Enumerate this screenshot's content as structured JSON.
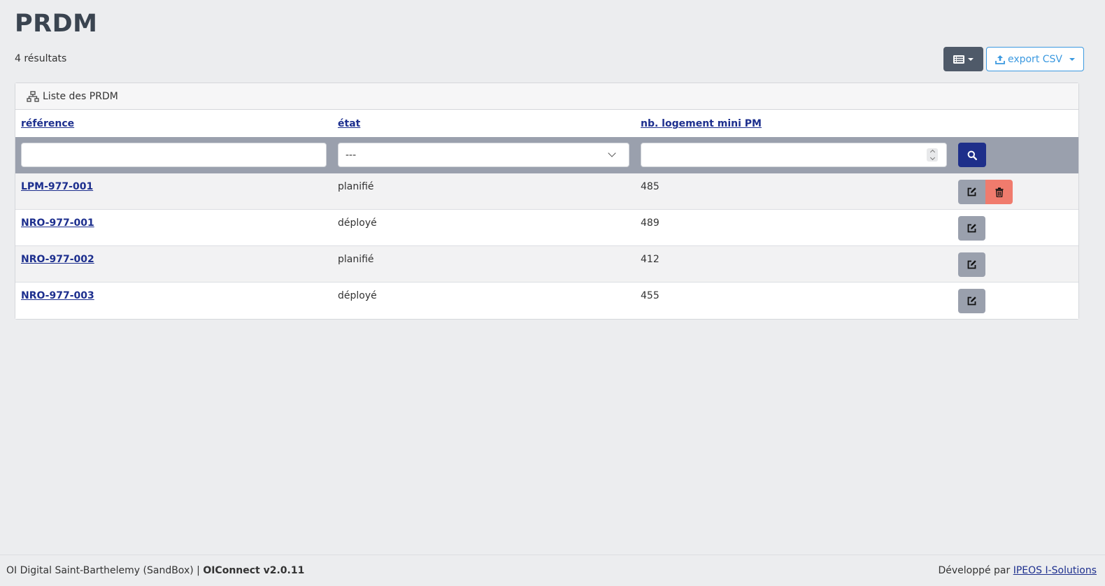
{
  "page": {
    "title": "PRDM",
    "result_count": "4 résultats"
  },
  "toolbar": {
    "columns_icon": "list-icon",
    "export_label": "export CSV",
    "export_icon": "upload-icon"
  },
  "card": {
    "title": "Liste des PRDM",
    "title_icon": "sitemap-icon"
  },
  "table": {
    "columns": [
      "référence",
      "état",
      "nb. logement mini PM"
    ],
    "filters": {
      "reference_value": "",
      "etat_value": "---",
      "nb_logement_value": ""
    },
    "rows": [
      {
        "reference": "LPM-977-001",
        "etat": "planifié",
        "nb_logement": "485",
        "deletable": true
      },
      {
        "reference": "NRO-977-001",
        "etat": "déployé",
        "nb_logement": "489",
        "deletable": false
      },
      {
        "reference": "NRO-977-002",
        "etat": "planifié",
        "nb_logement": "412",
        "deletable": false
      },
      {
        "reference": "NRO-977-003",
        "etat": "déployé",
        "nb_logement": "455",
        "deletable": false
      }
    ]
  },
  "footer": {
    "org": "OI Digital Saint-Barthelemy (SandBox) |",
    "app": "OIConnect v2.0.11",
    "dev_prefix": "Développé par",
    "dev_link": "IPEOS I-Solutions"
  },
  "colors": {
    "primary": "#1e2f8a",
    "link": "#1d2f8e",
    "danger": "#f07b6d",
    "secondary": "#9aa0ad",
    "dark": "#4f5a69",
    "info": "#3b99e0"
  }
}
